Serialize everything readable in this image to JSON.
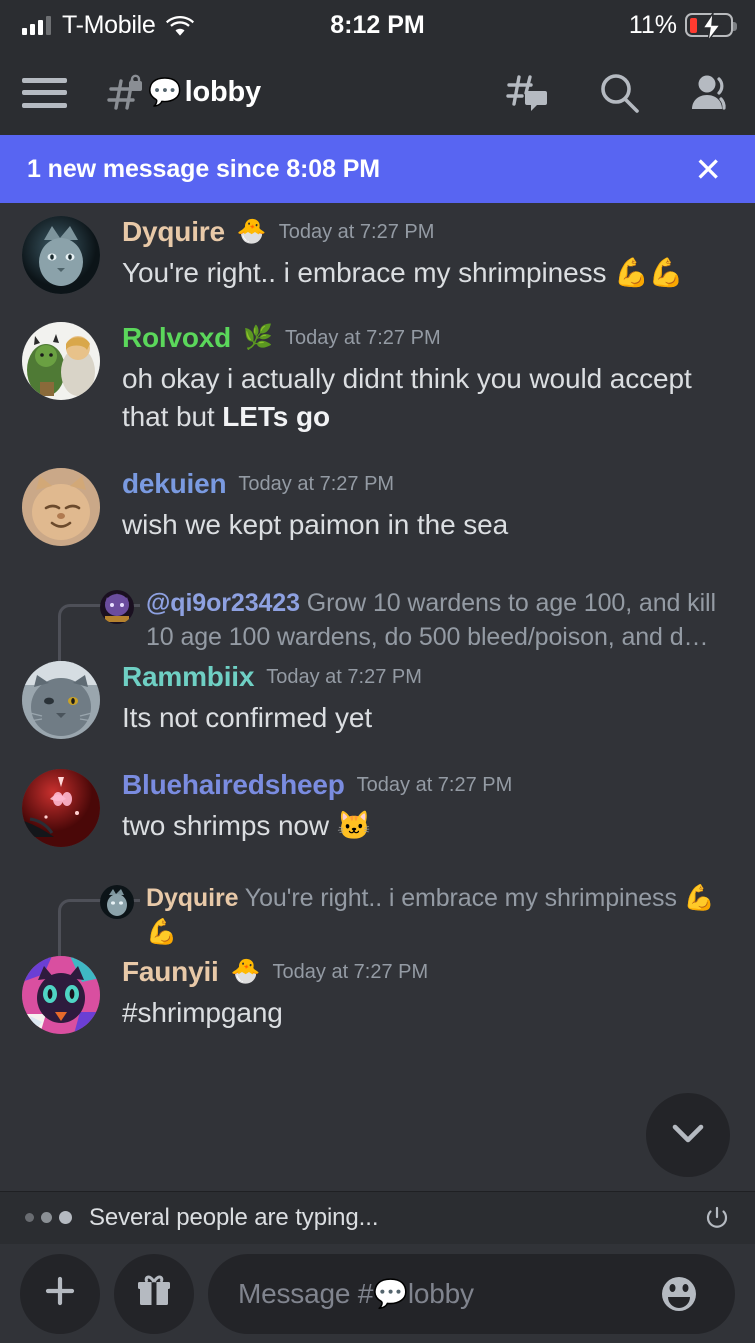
{
  "status_bar": {
    "carrier": "T-Mobile",
    "time": "8:12 PM",
    "battery_percent": "11%",
    "signal_icon": "cellular-signal-icon",
    "wifi_icon": "wifi-icon",
    "battery_icon": "battery-charging-icon"
  },
  "header": {
    "menu_icon": "hamburger-menu-icon",
    "channel_lock_icon": "private-channel-hash-lock-icon",
    "channel_emoji": "💬",
    "channel_name": "lobby",
    "threads_icon": "threads-icon",
    "search_icon": "search-icon",
    "members_icon": "members-icon"
  },
  "banner": {
    "text": "1 new message since 8:08 PM",
    "close_icon": "close-icon",
    "color": "#5865f2"
  },
  "messages": [
    {
      "id": "dyquire-1",
      "username": "Dyquire",
      "username_color": "#e8c9a8",
      "color_class": "c-tan",
      "badge": "🐣",
      "timestamp": "Today at 7:27 PM",
      "text": "You're right.. i embrace my shrimpiness 💪💪",
      "avatar": "gray-cat-avatar"
    },
    {
      "id": "rolvoxd-1",
      "username": "Rolvoxd",
      "username_color": "#5bd75b",
      "color_class": "c-green",
      "badge": "🌿",
      "timestamp": "Today at 7:27 PM",
      "text": "oh okay i actually didnt think you would accept that but ",
      "text_bold": "LETs go",
      "avatar": "anime-characters-avatar"
    },
    {
      "id": "dekuien-1",
      "username": "dekuien",
      "username_color": "#7a9ae0",
      "color_class": "c-blue",
      "badge": "",
      "timestamp": "Today at 7:27 PM",
      "text": "wish we kept paimon in the sea",
      "avatar": "orange-cat-avatar"
    },
    {
      "id": "rammbiix-1",
      "username": "Rammbiix",
      "username_color": "#6fd0c4",
      "color_class": "c-teal",
      "badge": "",
      "timestamp": "Today at 7:27 PM",
      "text": "Its not confirmed yet",
      "avatar": "gray-british-cat-avatar",
      "reply": {
        "user": "@qi9or23423",
        "user_style": "mention",
        "text": "Grow 10 wardens to age 100, and kill 10 age 100 wardens, do 500 bleed/poison, and d…",
        "avatar": "purple-monster-avatar"
      }
    },
    {
      "id": "bluehairedsheep-1",
      "username": "Bluehairedsheep",
      "username_color": "#7a8ce0",
      "color_class": "c-indigo",
      "badge": "",
      "timestamp": "Today at 7:27 PM",
      "text": "two shrimps now 🐱",
      "avatar": "red-butterfly-avatar"
    },
    {
      "id": "faunyii-1",
      "username": "Faunyii",
      "username_color": "#e8c9a8",
      "color_class": "c-tan",
      "badge": "🐣",
      "timestamp": "Today at 7:27 PM",
      "text": "#shrimpgang",
      "avatar": "pink-character-avatar",
      "reply": {
        "user": "Dyquire",
        "user_style": "tan",
        "text": "You're right.. i embrace my shrimpiness 💪💪",
        "avatar": "gray-cat-avatar"
      }
    }
  ],
  "scroll_to_bottom": {
    "icon": "chevron-down-icon"
  },
  "typing_indicator": {
    "text": "Several people are typing...",
    "dots_icon": "typing-dots-icon",
    "end_icon": "power-icon"
  },
  "composer": {
    "add_icon": "plus-icon",
    "gift_icon": "gift-icon",
    "placeholder_prefix": "Message #",
    "placeholder_emoji": "💬",
    "placeholder_channel": "lobby",
    "emoji_icon": "emoji-smiley-icon"
  }
}
